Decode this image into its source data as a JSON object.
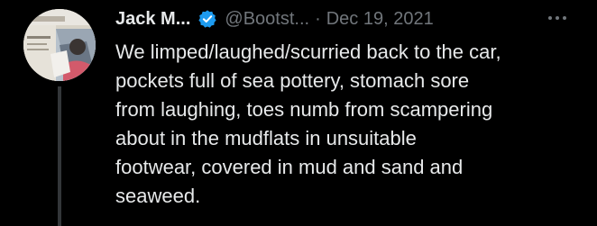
{
  "tweet": {
    "author": "Jack M...",
    "handle": "@Bootst...",
    "separator": "·",
    "date": "Dec 19, 2021",
    "body_lines": [
      "We limped/laughed/scurried back to the car,",
      "pockets full of sea pottery, stomach sore",
      "from laughing, toes numb from scampering",
      "about in the mudflats in unsuitable",
      "footwear, covered in mud and sand and",
      "seaweed."
    ]
  },
  "colors": {
    "background": "#000000",
    "text": "#e7e9ea",
    "secondary": "#71767b",
    "verified": "#1d9bf0",
    "thread_line": "#333639"
  },
  "icons": {
    "verified": "verified-badge-icon",
    "more": "more-horizontal-icon"
  }
}
